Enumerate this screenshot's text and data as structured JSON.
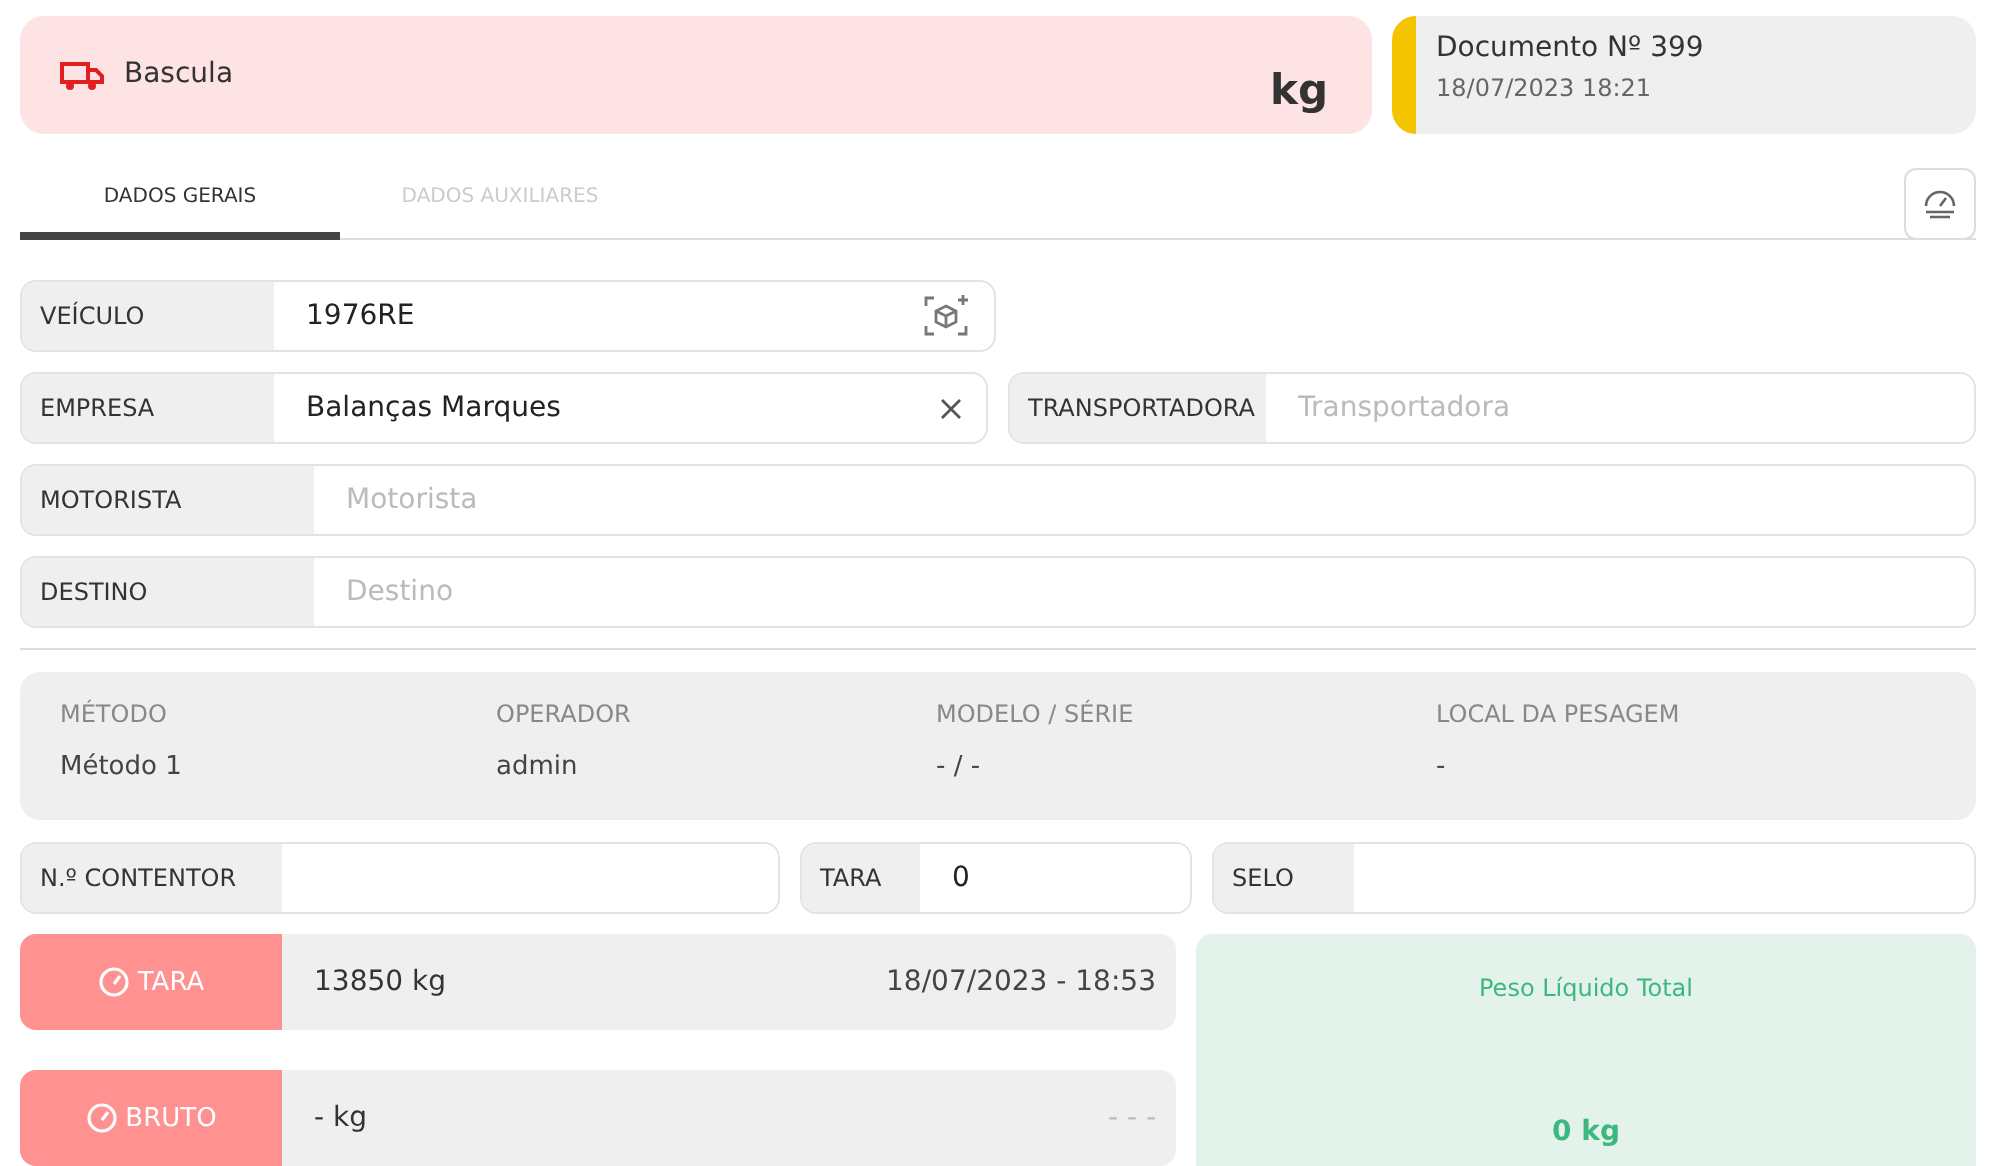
{
  "scale": {
    "name": "Bascula",
    "unit": "kg"
  },
  "document": {
    "title": "Documento Nº 399",
    "datetime": "18/07/2023 18:21"
  },
  "tabs": [
    {
      "label": "DADOS GERAIS",
      "selected": true
    },
    {
      "label": "DADOS AUXILIARES",
      "selected": false
    }
  ],
  "fields": {
    "vehicle": {
      "label": "VEÍCULO",
      "value": "1976RE"
    },
    "company": {
      "label": "EMPRESA",
      "value": "Balanças Marques"
    },
    "carrier": {
      "label": "TRANSPORTADORA",
      "placeholder": "Transportadora"
    },
    "driver": {
      "label": "MOTORISTA",
      "placeholder": "Motorista"
    },
    "destination": {
      "label": "DESTINO",
      "placeholder": "Destino"
    }
  },
  "info": [
    {
      "label": "MÉTODO",
      "value": "Método 1"
    },
    {
      "label": "OPERADOR",
      "value": "admin"
    },
    {
      "label": "MODELO / SÉRIE",
      "value": "- / -"
    },
    {
      "label": "LOCAL DA PESAGEM",
      "value": "-"
    }
  ],
  "small_fields": [
    {
      "label": "N.º CONTENTOR"
    },
    {
      "label": "TARA",
      "value": "0"
    },
    {
      "label": "SELO"
    }
  ],
  "weighings": [
    {
      "label": "TARA",
      "weight": "13850 kg",
      "datetime": "18/07/2023 - 18:53"
    },
    {
      "label": "BRUTO",
      "weight": "- kg",
      "datetime": "- - -"
    }
  ],
  "net": {
    "title": "Peso Líquido Total",
    "value": "0 kg"
  }
}
